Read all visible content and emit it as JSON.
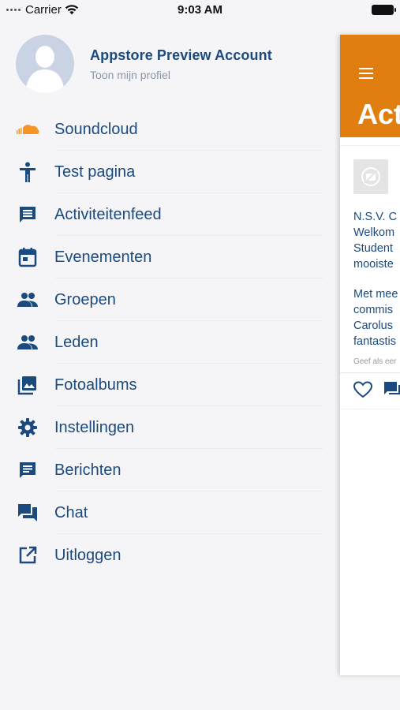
{
  "status_bar": {
    "carrier": "Carrier",
    "time": "9:03 AM"
  },
  "profile": {
    "name": "Appstore Preview Account",
    "link": "Toon mijn profiel"
  },
  "menu": [
    {
      "label": "Soundcloud",
      "icon": "soundcloud-icon"
    },
    {
      "label": "Test pagina",
      "icon": "accessibility-icon"
    },
    {
      "label": "Activiteitenfeed",
      "icon": "comment-icon"
    },
    {
      "label": "Evenementen",
      "icon": "calendar-icon"
    },
    {
      "label": "Groepen",
      "icon": "group-icon"
    },
    {
      "label": "Leden",
      "icon": "people-icon"
    },
    {
      "label": "Fotoalbums",
      "icon": "photo-library-icon"
    },
    {
      "label": "Instellingen",
      "icon": "gear-icon"
    },
    {
      "label": "Berichten",
      "icon": "message-icon"
    },
    {
      "label": "Chat",
      "icon": "chat-icon"
    },
    {
      "label": "Uitloggen",
      "icon": "logout-icon"
    }
  ],
  "panel": {
    "title": "Act",
    "post_lines_1": [
      "N.S.V. C",
      "Welkom",
      "Student",
      "mooiste"
    ],
    "post_lines_2": [
      "Met mee",
      "commis",
      "Carolus",
      "fantastis"
    ],
    "post_meta": "Geef als eer"
  },
  "colors": {
    "accent": "#e07f0f",
    "text": "#1b4a7e",
    "soundcloud": "#f59526"
  }
}
